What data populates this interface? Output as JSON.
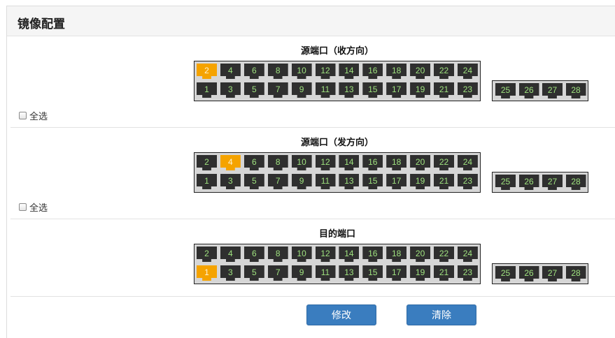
{
  "panel": {
    "title": "镜像配置"
  },
  "sections": [
    {
      "title": "源端口（收方向）",
      "select_all_label": "全选",
      "top_ports": [
        "2",
        "4",
        "6",
        "8",
        "10",
        "12",
        "14",
        "16",
        "18",
        "20",
        "22",
        "24"
      ],
      "bottom_ports": [
        "1",
        "3",
        "5",
        "7",
        "9",
        "11",
        "13",
        "15",
        "17",
        "19",
        "21",
        "23"
      ],
      "sfp_ports": [
        "25",
        "26",
        "27",
        "28"
      ],
      "selected": [
        "2"
      ]
    },
    {
      "title": "源端口（发方向）",
      "select_all_label": "全选",
      "top_ports": [
        "2",
        "4",
        "6",
        "8",
        "10",
        "12",
        "14",
        "16",
        "18",
        "20",
        "22",
        "24"
      ],
      "bottom_ports": [
        "1",
        "3",
        "5",
        "7",
        "9",
        "11",
        "13",
        "15",
        "17",
        "19",
        "21",
        "23"
      ],
      "sfp_ports": [
        "25",
        "26",
        "27",
        "28"
      ],
      "selected": [
        "4"
      ]
    },
    {
      "title": "目的端口",
      "select_all_label": "",
      "top_ports": [
        "2",
        "4",
        "6",
        "8",
        "10",
        "12",
        "14",
        "16",
        "18",
        "20",
        "22",
        "24"
      ],
      "bottom_ports": [
        "1",
        "3",
        "5",
        "7",
        "9",
        "11",
        "13",
        "15",
        "17",
        "19",
        "21",
        "23"
      ],
      "sfp_ports": [
        "25",
        "26",
        "27",
        "28"
      ],
      "selected": [
        "1"
      ]
    }
  ],
  "buttons": {
    "modify_label": "修改",
    "clear_label": "清除"
  },
  "colors": {
    "port": "#2f2f2f",
    "port_selected": "#f5a300",
    "port_number": "#9fe37f",
    "button": "#3a7dbf"
  }
}
